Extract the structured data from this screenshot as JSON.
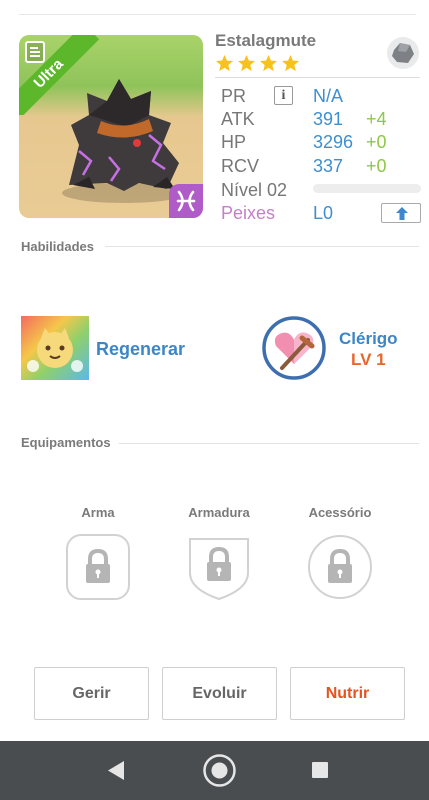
{
  "monster": {
    "name": "Estalagmute",
    "rarity": "Ultra",
    "stars": 4,
    "element_icon": "pisces-icon",
    "type_icon": "rock-icon",
    "stats": [
      {
        "label": "PR",
        "value": "N/A",
        "bonus": ""
      },
      {
        "label": "ATK",
        "value": "391",
        "bonus": "+4"
      },
      {
        "label": "HP",
        "value": "3296",
        "bonus": "+0"
      },
      {
        "label": "RCV",
        "value": "337",
        "bonus": "+0"
      }
    ],
    "level_label": "Nível 02",
    "level_progress": 0,
    "fish_label": "Peixes",
    "fish_value": "L0"
  },
  "sections": {
    "skills_title": "Habilidades",
    "equipment_title": "Equipamentos"
  },
  "skill": {
    "name": "Regenerar"
  },
  "class": {
    "name": "Clérigo",
    "level": "LV 1"
  },
  "equipment": [
    {
      "label": "Arma"
    },
    {
      "label": "Armadura"
    },
    {
      "label": "Acessório"
    }
  ],
  "actions": {
    "manage": "Gerir",
    "evolve": "Evoluir",
    "feed": "Nutrir"
  },
  "colors": {
    "accent_blue": "#3d8fd0",
    "bonus_green": "#8cc84b",
    "feed_orange": "#e8521f",
    "rarity_green": "#5cb82a",
    "fish_purple": "#c57fc8"
  }
}
